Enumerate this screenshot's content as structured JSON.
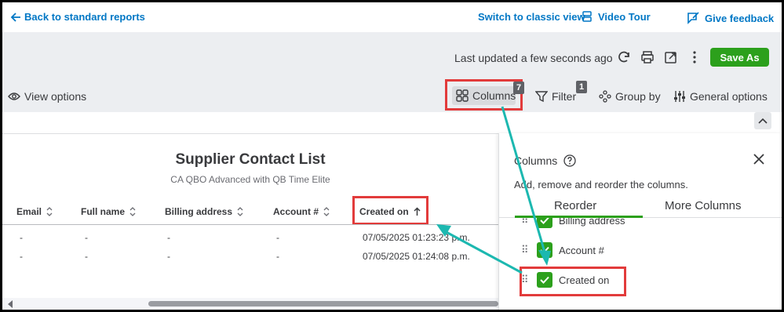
{
  "topbar": {
    "back_label": "Back to standard reports",
    "switch_label": "Switch to classic view",
    "video_label": "Video Tour",
    "feedback_label": "Give feedback"
  },
  "toolbar": {
    "updated_text": "Last updated a few seconds ago",
    "save_label": "Save As",
    "view_options_label": "View options",
    "columns_label": "Columns",
    "columns_badge": "7",
    "filter_label": "Filter",
    "filter_badge": "1",
    "group_label": "Group by",
    "general_label": "General options"
  },
  "report": {
    "title": "Supplier Contact List",
    "subtitle": "CA QBO Advanced with QB Time Elite",
    "columns": [
      "Email",
      "Full name",
      "Billing address",
      "Account #",
      "Created on"
    ],
    "rows": [
      [
        "-",
        "-",
        "-",
        "-",
        "07/05/2025 01:23:23 p.m."
      ],
      [
        "-",
        "-",
        "-",
        "-",
        "07/05/2025 01:24:08 p.m."
      ]
    ]
  },
  "panel": {
    "title": "Columns",
    "description": "Add, remove and reorder the columns.",
    "tab_reorder": "Reorder",
    "tab_more": "More Columns",
    "items": [
      "Billing address",
      "Account #",
      "Created on"
    ]
  },
  "colors": {
    "accent_green": "#2ca01c",
    "link_blue": "#0077c5",
    "highlight_red": "#e23b3b",
    "arrow_teal": "#1cb8b0"
  }
}
